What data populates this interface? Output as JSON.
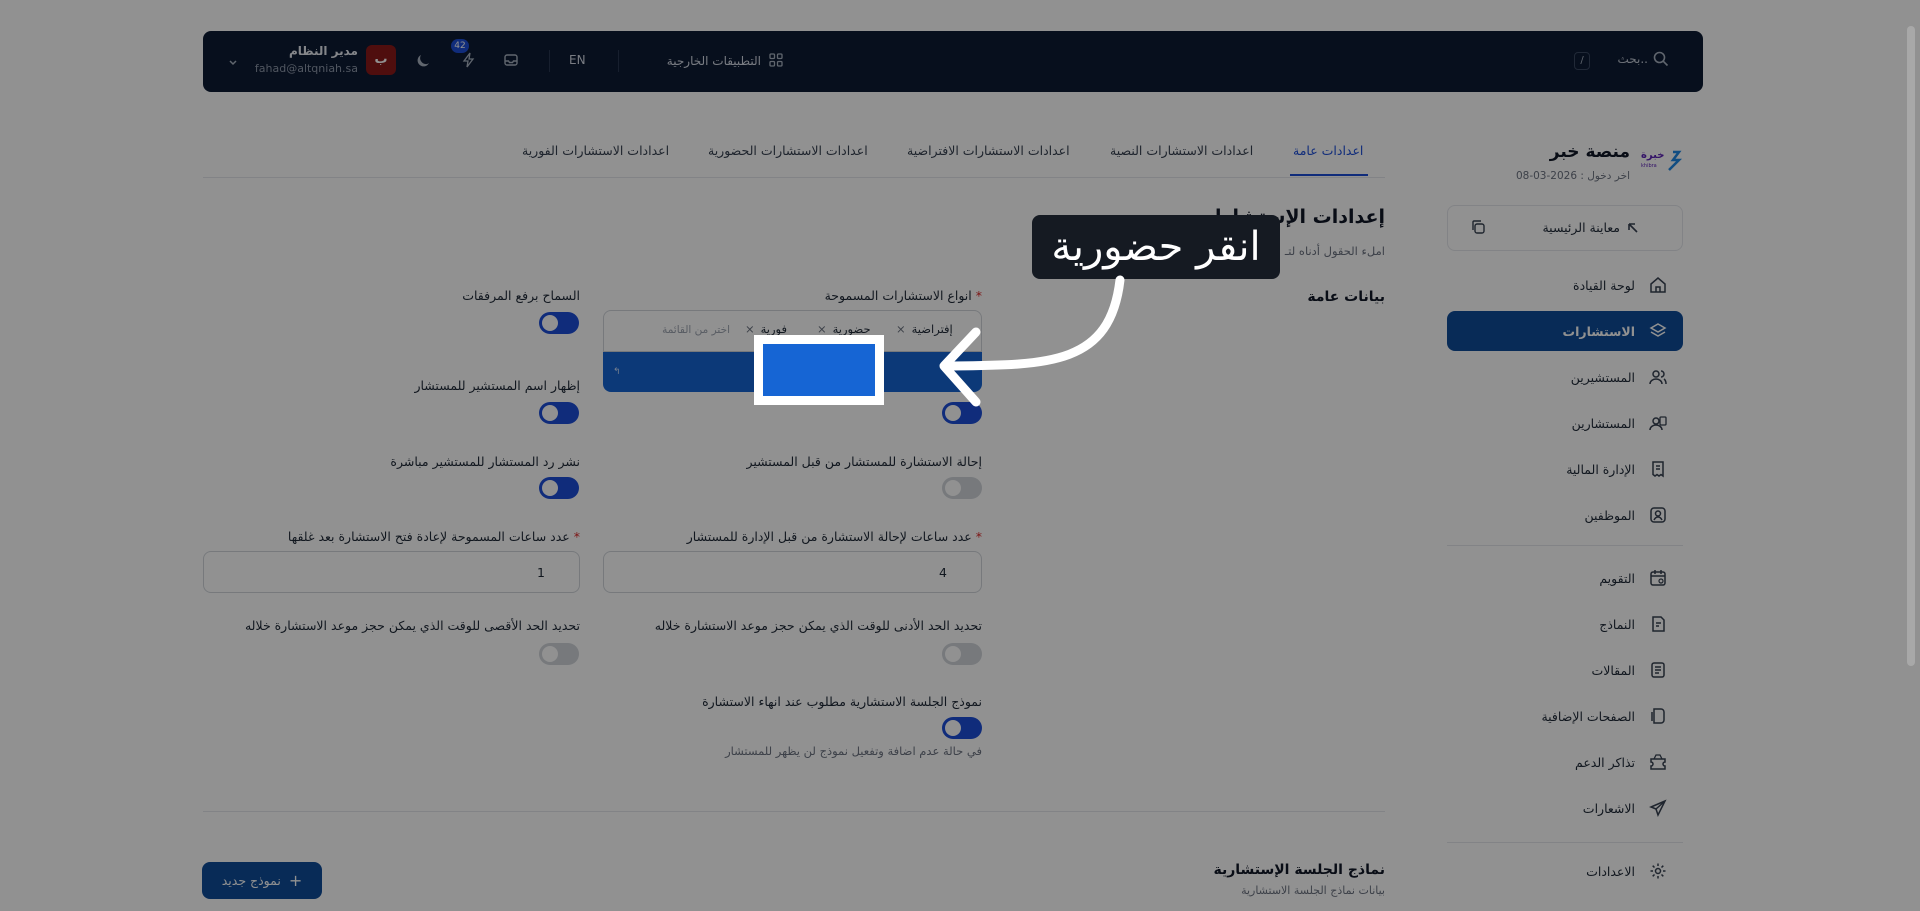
{
  "topbar": {
    "search_placeholder": "بحث..",
    "search_shortcut": "/",
    "external_apps_label": "التطبيقات الخارجية",
    "language_label": "EN",
    "notifications_count": "42",
    "user_name": "مدير النظام",
    "user_email": "fahad@altqniah.sa",
    "avatar_letter": "ب"
  },
  "platform": {
    "name": "منصة خبر",
    "last_login": "اخر دخول : 2026-03-08",
    "logo_text": "خبرة",
    "logo_subtext": "khibra"
  },
  "sidebar": {
    "preview_label": "معاينة الرئيسية",
    "items": [
      {
        "label": "لوحة القيادة",
        "icon": "home-icon"
      },
      {
        "label": "الاستشارات",
        "icon": "layers-icon",
        "active": true
      },
      {
        "label": "المستشيرين",
        "icon": "users-icon"
      },
      {
        "label": "المستشارين",
        "icon": "user-card-icon"
      },
      {
        "label": "الإدارة المالية",
        "icon": "receipt-icon"
      },
      {
        "label": "الموظفين",
        "icon": "employee-icon"
      },
      {
        "label": "التقويم",
        "icon": "calendar-icon"
      },
      {
        "label": "النماذج",
        "icon": "form-icon"
      },
      {
        "label": "المقالات",
        "icon": "article-icon"
      },
      {
        "label": "الصفحات الإضافية",
        "icon": "pages-icon"
      },
      {
        "label": "تذاكر الدعم",
        "icon": "ticket-icon"
      },
      {
        "label": "الاشعارات",
        "icon": "send-icon"
      },
      {
        "label": "الاعدادات",
        "icon": "gear-icon"
      }
    ]
  },
  "tabs": [
    {
      "label": "اعدادات عامة",
      "active": true
    },
    {
      "label": "اعدادات الاستشارات النصية"
    },
    {
      "label": "اعدادات الاستشارات الافتراضية"
    },
    {
      "label": "اعدادات الاستشارات الحضورية"
    },
    {
      "label": "اعدادات الاستشارات الفورية"
    }
  ],
  "page": {
    "title": "إعدادات الإستشارات",
    "subtitle": "املء الحقول أدناه لتـ",
    "section_title": "بيانات عامة"
  },
  "form": {
    "allowed_types_label": "انواع الاستشارات المسموحة",
    "allowed_types_tags": [
      "إفتراضية",
      "حضورية",
      "فورية"
    ],
    "allowed_types_placeholder": "اختر من القائمة",
    "allow_attachments_label": "السماح برفع المرفقات",
    "show_client_name_label": "إظهار اسم المستشير للمستشار",
    "refer_consultation_label": "إحالة الاستشارة للمستشار من قبل المستشير",
    "publish_reply_label": "نشر رد المستشار للمستشير مباشرة",
    "referral_hours_label": "عدد ساعات لإحالة الاستشارة من قبل الإدارة للمستشار",
    "referral_hours_value": "4",
    "reopen_hours_label": "عدد ساعات المسموحة لإعادة فتح الاستشارة بعد غلقها",
    "reopen_hours_value": "1",
    "min_booking_label": "تحديد الحد الأدنى للوقت الذي يمكن حجز موعد الاستشارة خلاله",
    "max_booking_label": "تحديد الحد الأقصى للوقت الذي يمكن حجز موعد الاستشارة خلاله",
    "session_form_required_label": "نموذج الجلسة الاستشارية مطلوب عند انهاء الاستشارة",
    "session_form_hint": "في حالة عدم اضافة وتفعيل نموذج لن يظهر للمستشار"
  },
  "session_forms": {
    "title": "نماذج الجلسة الإستشارية",
    "subtitle": "بيانات نماذج الجلسة الاستشارية",
    "new_button": "نموذج جديد"
  },
  "overlay": {
    "instruction": "انقر حضورية"
  },
  "colors": {
    "accent": "#0f4c99",
    "toggle_on": "#1d4ed8",
    "topbar": "#0d1b33"
  }
}
